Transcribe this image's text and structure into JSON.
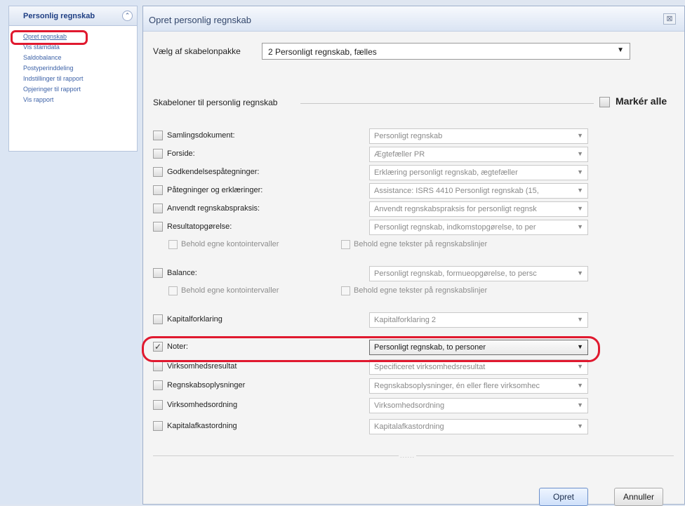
{
  "sidebar": {
    "title": "Personlig regnskab",
    "collapse_glyph": "⌃",
    "items": [
      {
        "label": "Opret regnskab",
        "active": true
      },
      {
        "label": "Vis stamdata"
      },
      {
        "label": "Saldobalance"
      },
      {
        "label": "Postyperinddeling"
      },
      {
        "label": "Indstillinger til rapport"
      },
      {
        "label": "Opjeringer til rapport"
      },
      {
        "label": "Vis rapport"
      }
    ]
  },
  "dialog": {
    "title": "Opret personlig regnskab",
    "close_glyph": "⊠",
    "package_label": "Vælg af skabelonpakke",
    "package_value": "2 Personligt regnskab, fælles",
    "section_label": "Skabeloner til personlig regnskab",
    "mark_all_label": "Markér alle",
    "templates": [
      {
        "name": "Samlingsdokument:",
        "value": "Personligt regnskab",
        "checked": false
      },
      {
        "name": "Forside:",
        "value": "Ægtefæller PR",
        "checked": false
      },
      {
        "name": "Godkendelsespåtegninger:",
        "value": "Erklæring personligt regnskab, ægtefæller",
        "checked": false
      },
      {
        "name": "Påtegninger og erklæringer:",
        "value": "Assistance: ISRS 4410 Personligt regnskab (15,",
        "checked": false
      },
      {
        "name": "Anvendt regnskabspraksis:",
        "value": "Anvendt regnskabspraksis for personligt regnsk",
        "checked": false
      },
      {
        "name": "Resultatopgørelse:",
        "value": "Personligt regnskab, indkomstopgørelse, to per",
        "checked": false
      },
      {
        "name": "Balance:",
        "value": "Personligt regnskab, formueopgørelse, to persc",
        "checked": false
      },
      {
        "name": "Kapitalforklaring",
        "value": "Kapitalforklaring 2",
        "checked": false
      },
      {
        "name": "Noter:",
        "value": "Personligt regnskab, to personer",
        "checked": true
      },
      {
        "name": "Virksomhedsresultat",
        "value": "Specificeret virksomhedsresultat",
        "checked": false
      },
      {
        "name": "Regnskabsoplysninger",
        "value": "Regnskabsoplysninger, én eller flere virksomhec",
        "checked": false
      },
      {
        "name": "Virksomhedsordning",
        "value": "Virksomhedsordning",
        "checked": false
      },
      {
        "name": "Kapitalafkastordning",
        "value": "Kapitalafkastordning",
        "checked": false
      }
    ],
    "suboptions": {
      "keep_intervals": "Behold egne kontointervaller",
      "keep_texts": "Behold egne tekster på regnskabslinjer"
    },
    "separator_mark": "......",
    "buttons": {
      "create": "Opret",
      "cancel": "Annuller"
    }
  },
  "colors": {
    "annotation": "#e0192f",
    "link": "#3e63a8"
  }
}
